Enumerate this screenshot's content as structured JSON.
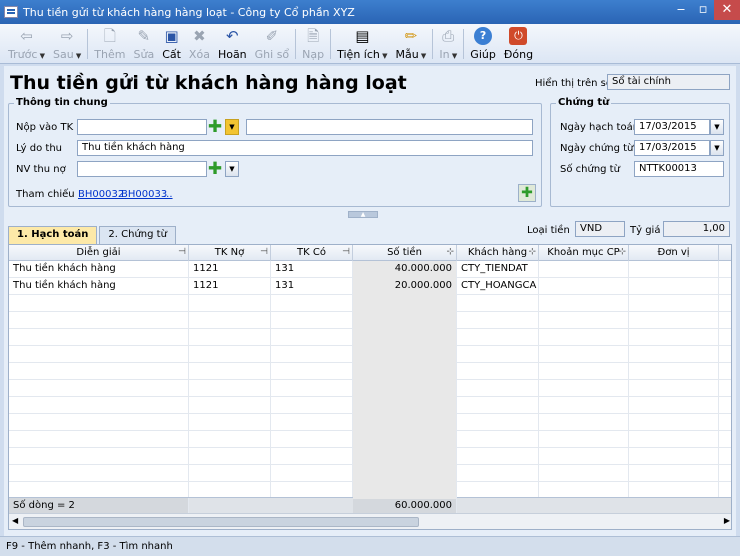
{
  "window": {
    "title": "Thu tiền gửi từ khách hàng hàng loạt - Công ty Cổ phần XYZ"
  },
  "toolbar": {
    "items": [
      {
        "label": "Trước",
        "icon": "arrow-left-icon",
        "glyph": "⇦",
        "enabled": false,
        "dropdown": true
      },
      {
        "label": "Sau",
        "icon": "arrow-right-icon",
        "glyph": "⇨",
        "enabled": false,
        "dropdown": true
      },
      {
        "label": "Thêm",
        "icon": "add-document-icon",
        "glyph": "🗋",
        "enabled": false
      },
      {
        "label": "Sửa",
        "icon": "edit-document-icon",
        "glyph": "✎",
        "enabled": false
      },
      {
        "label": "Cất",
        "icon": "save-disk-icon",
        "glyph": "▣",
        "enabled": true
      },
      {
        "label": "Xóa",
        "icon": "delete-icon",
        "glyph": "✖",
        "enabled": false
      },
      {
        "label": "Hoãn",
        "icon": "undo-icon",
        "glyph": "↶",
        "enabled": true
      },
      {
        "label": "Ghi sổ",
        "icon": "pencil-icon",
        "glyph": "✐",
        "enabled": false
      },
      {
        "label": "Nạp",
        "icon": "reload-icon",
        "glyph": "🗎",
        "enabled": false
      },
      {
        "label": "Tiện ích",
        "icon": "utilities-icon",
        "glyph": "▤",
        "enabled": true,
        "dropdown": true
      },
      {
        "label": "Mẫu",
        "icon": "template-icon",
        "glyph": "✏",
        "enabled": true,
        "dropdown": true
      },
      {
        "label": "In",
        "icon": "printer-icon",
        "glyph": "⎙",
        "enabled": false,
        "dropdown": true
      },
      {
        "label": "Giúp",
        "icon": "help-icon",
        "glyph": "?",
        "enabled": true
      },
      {
        "label": "Đóng",
        "icon": "close-power-icon",
        "glyph": "⏻",
        "enabled": true
      }
    ]
  },
  "page": {
    "title": "Thu tiền gửi từ khách hàng hàng loạt",
    "display_on_ledger_label": "Hiển thị trên sổ",
    "display_on_ledger_value": "Sổ tài chính"
  },
  "general": {
    "title": "Thông tin chung",
    "deposit_account_label": "Nộp vào TK",
    "deposit_account_value": "",
    "deposit_account_name": "",
    "reason_label": "Lý do thu",
    "reason_value": "Thu tiền khách hàng",
    "collector_label": "NV thu nợ",
    "collector_value": "",
    "reference_label": "Tham chiếu",
    "references": [
      "BH00032",
      "BH00033",
      "..."
    ]
  },
  "voucher": {
    "title": "Chứng từ",
    "posting_date_label": "Ngày hạch toán",
    "posting_date_value": "17/03/2015",
    "voucher_date_label": "Ngày chứng từ",
    "voucher_date_value": "17/03/2015",
    "voucher_no_label": "Số chứng từ",
    "voucher_no_value": "NTTK00013"
  },
  "currency": {
    "currency_label": "Loại tiền",
    "currency_value": "VND",
    "rate_label": "Tỷ giá",
    "rate_value": "1,00"
  },
  "tabs": [
    {
      "label": "1. Hạch toán",
      "active": true
    },
    {
      "label": "2. Chứng từ",
      "active": false
    }
  ],
  "grid": {
    "columns": [
      "Diễn giải",
      "TK Nợ",
      "TK Có",
      "Số tiền",
      "Khách hàng",
      "Khoản mục CP",
      "Đơn vị"
    ],
    "rows": [
      [
        "Thu tiền khách hàng",
        "1121",
        "131",
        "40.000.000",
        "CTY_TIENDAT",
        "",
        ""
      ],
      [
        "Thu tiền khách hàng",
        "1121",
        "131",
        "20.000.000",
        "CTY_HOANGCA",
        "",
        ""
      ]
    ],
    "footer_count": "Số dòng = 2",
    "footer_total": "60.000.000"
  },
  "status": {
    "text": "F9 - Thêm nhanh, F3 - Tìm nhanh"
  }
}
